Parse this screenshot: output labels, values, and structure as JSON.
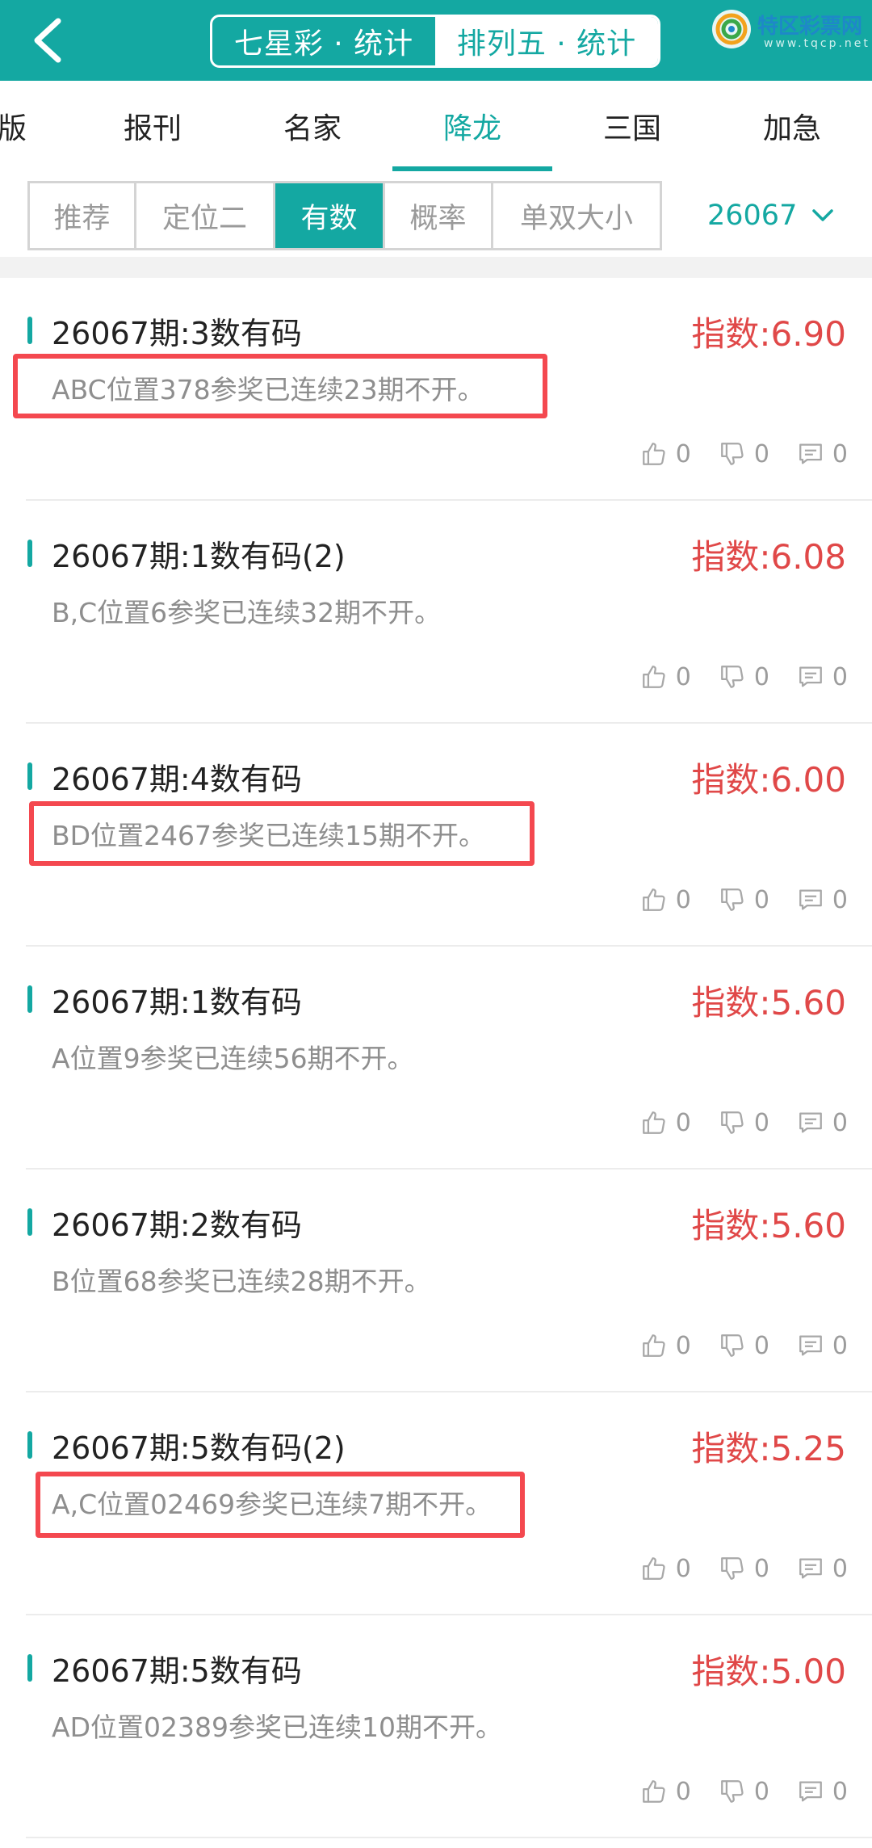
{
  "header": {
    "segments": [
      {
        "label": "七星彩 · 统计",
        "active": false
      },
      {
        "label": "排列五 · 统计",
        "active": true
      }
    ],
    "logo": {
      "name": "特区彩票网",
      "sub": "www.tqcp.net"
    }
  },
  "tabs": [
    {
      "label": "版",
      "active": false
    },
    {
      "label": "报刊",
      "active": false
    },
    {
      "label": "名家",
      "active": false
    },
    {
      "label": "降龙",
      "active": true
    },
    {
      "label": "三国",
      "active": false
    },
    {
      "label": "加急",
      "active": false
    }
  ],
  "filters": [
    {
      "label": "推荐",
      "active": false
    },
    {
      "label": "定位二",
      "active": false
    },
    {
      "label": "有数",
      "active": true
    },
    {
      "label": "概率",
      "active": false
    },
    {
      "label": "单双大小",
      "active": false
    }
  ],
  "period": {
    "value": "26067"
  },
  "items": [
    {
      "title": "26067期:3数有码",
      "index": "指数:6.90",
      "desc": "ABC位置378参奖已连续23期不开。",
      "likes": "0",
      "dislikes": "0",
      "comments": "0"
    },
    {
      "title": "26067期:1数有码(2)",
      "index": "指数:6.08",
      "desc": "B,C位置6参奖已连续32期不开。",
      "likes": "0",
      "dislikes": "0",
      "comments": "0"
    },
    {
      "title": "26067期:4数有码",
      "index": "指数:6.00",
      "desc": "BD位置2467参奖已连续15期不开。",
      "likes": "0",
      "dislikes": "0",
      "comments": "0"
    },
    {
      "title": "26067期:1数有码",
      "index": "指数:5.60",
      "desc": "A位置9参奖已连续56期不开。",
      "likes": "0",
      "dislikes": "0",
      "comments": "0"
    },
    {
      "title": "26067期:2数有码",
      "index": "指数:5.60",
      "desc": "B位置68参奖已连续28期不开。",
      "likes": "0",
      "dislikes": "0",
      "comments": "0"
    },
    {
      "title": "26067期:5数有码(2)",
      "index": "指数:5.25",
      "desc": "A,C位置02469参奖已连续7期不开。",
      "likes": "0",
      "dislikes": "0",
      "comments": "0"
    },
    {
      "title": "26067期:5数有码",
      "index": "指数:5.00",
      "desc": "AD位置02389参奖已连续10期不开。",
      "likes": "0",
      "dislikes": "0",
      "comments": "0"
    }
  ],
  "colors": {
    "accent": "#14a8a2",
    "index": "#e04848",
    "highlight": "#f4484f"
  }
}
